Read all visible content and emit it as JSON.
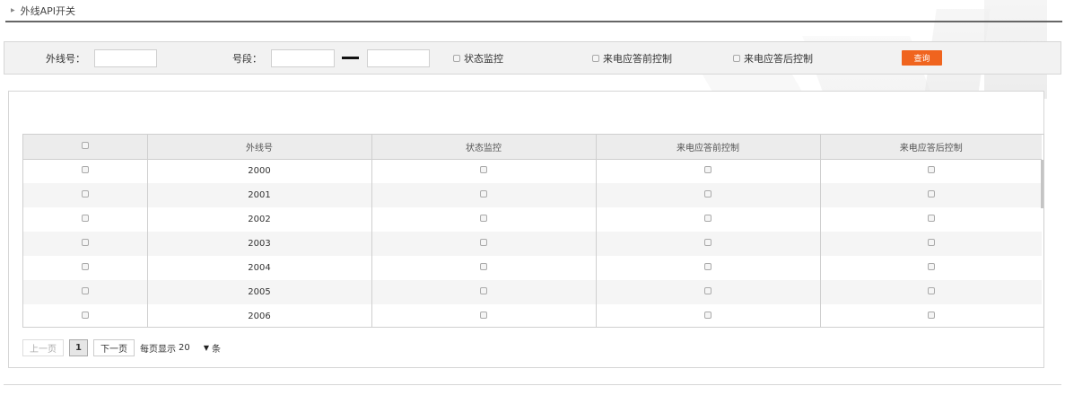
{
  "title": "外线API开关",
  "filter": {
    "trunk_label": "外线号：",
    "range_label": "号段：",
    "status_label": "状态监控",
    "pre_answer_label": "来电应答前控制",
    "post_answer_label": "来电应答后控制",
    "query_label": "查询"
  },
  "table": {
    "headers": [
      "外线号",
      "状态监控",
      "来电应答前控制",
      "来电应答后控制"
    ],
    "rows": [
      "2000",
      "2001",
      "2002",
      "2003",
      "2004",
      "2005",
      "2006"
    ]
  },
  "pager": {
    "prev": "上一页",
    "current": "1",
    "next": "下一页",
    "per_page_label": "每页显示",
    "per_page_value": "20",
    "unit": "条"
  }
}
